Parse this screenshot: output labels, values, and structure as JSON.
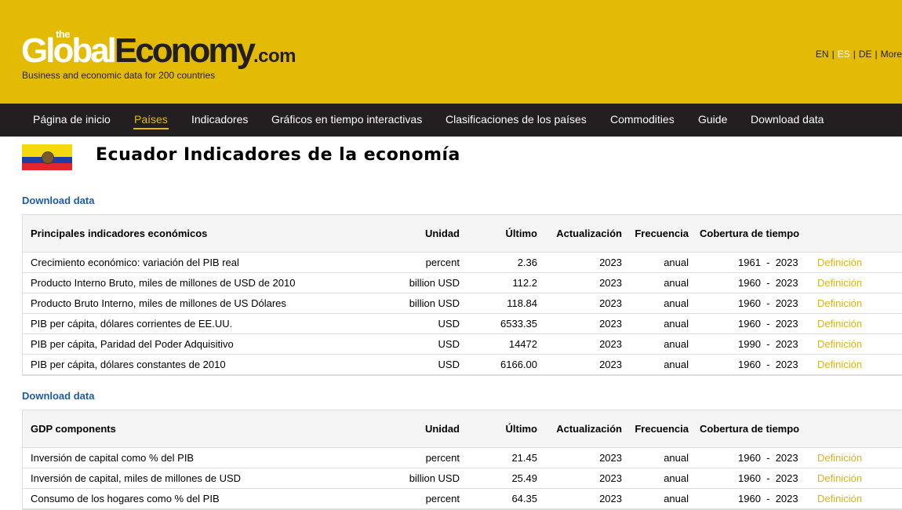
{
  "site": {
    "logo_the": "the",
    "logo_global": "Global",
    "logo_economy": "Economy",
    "logo_com": ".com",
    "tagline": "Business and economic data for 200 countries",
    "langs": [
      "EN",
      "ES",
      "DE",
      "More"
    ],
    "active_lang": "ES"
  },
  "nav": {
    "items": [
      "Página de inicio",
      "Países",
      "Indicadores",
      "Gráficos en tiempo interactivas",
      "Clasificaciones de los países",
      "Commodities",
      "Guide",
      "Download data"
    ],
    "active": "Países"
  },
  "page": {
    "title": "Ecuador Indicadores de la economía",
    "flag": "ecuador-flag"
  },
  "headers": {
    "unit": "Unidad",
    "last": "Último",
    "update": "Actualización",
    "freq": "Frecuencia",
    "coverage": "Cobertura de tiempo"
  },
  "sections": [
    {
      "download": "Download data",
      "title": "Principales indicadores económicos",
      "rows": [
        {
          "name": "Crecimiento económico: variación del PIB real",
          "unit": "percent",
          "last": "2.36",
          "update": "2023",
          "freq": "anual",
          "coverage": "1961  -  2023",
          "def": "Definición"
        },
        {
          "name": "Producto Interno Bruto, miles de millones de USD de 2010",
          "unit": "billion USD",
          "last": "112.2",
          "update": "2023",
          "freq": "anual",
          "coverage": "1960  -  2023",
          "def": "Definición"
        },
        {
          "name": "Producto Bruto Interno, miles de millones de US Dólares",
          "unit": "billion USD",
          "last": "118.84",
          "update": "2023",
          "freq": "anual",
          "coverage": "1960  -  2023",
          "def": "Definición"
        },
        {
          "name": "PIB per cápita, dólares corrientes de EE.UU.",
          "unit": "USD",
          "last": "6533.35",
          "update": "2023",
          "freq": "anual",
          "coverage": "1960  -  2023",
          "def": "Definición"
        },
        {
          "name": "PIB per cápita, Paridad del Poder Adquisitivo",
          "unit": "USD",
          "last": "14472",
          "update": "2023",
          "freq": "anual",
          "coverage": "1990  -  2023",
          "def": "Definición"
        },
        {
          "name": "PIB per cápita, dólares constantes de 2010",
          "unit": "USD",
          "last": "6166.00",
          "update": "2023",
          "freq": "anual",
          "coverage": "1960  -  2023",
          "def": "Definición"
        }
      ]
    },
    {
      "download": "Download data",
      "title": "GDP components",
      "rows": [
        {
          "name": "Inversión de capital como % del PIB",
          "unit": "percent",
          "last": "21.45",
          "update": "2023",
          "freq": "anual",
          "coverage": "1960  -  2023",
          "def": "Definición"
        },
        {
          "name": "Inversión de capital, miles de millones de USD",
          "unit": "billion USD",
          "last": "25.49",
          "update": "2023",
          "freq": "anual",
          "coverage": "1960  -  2023",
          "def": "Definición"
        },
        {
          "name": "Consumo de los hogares como % del PIB",
          "unit": "percent",
          "last": "64.35",
          "update": "2023",
          "freq": "anual",
          "coverage": "1960  -  2023",
          "def": "Definición"
        }
      ]
    }
  ]
}
